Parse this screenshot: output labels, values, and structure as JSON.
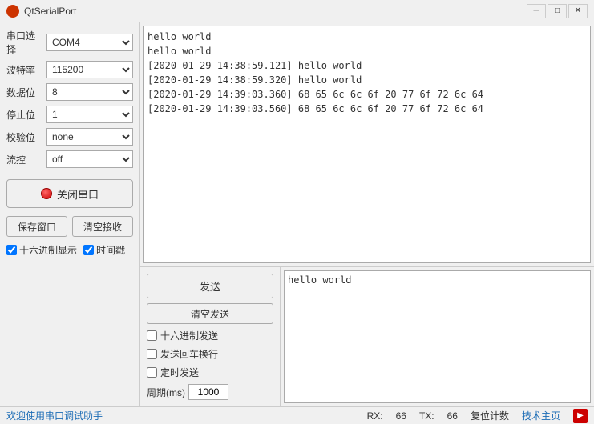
{
  "titleBar": {
    "title": "QtSerialPort",
    "minBtn": "─",
    "maxBtn": "□",
    "closeBtn": "✕"
  },
  "leftPanel": {
    "portLabel": "串口选择",
    "baudLabel": "波特率",
    "dataLabel": "数据位",
    "stopLabel": "停止位",
    "parityLabel": "校验位",
    "flowLabel": "流控",
    "portValue": "COM4",
    "baudValue": "115200",
    "dataValue": "8",
    "stopValue": "1",
    "parityValue": "none",
    "flowValue": "off",
    "openPortBtn": "关闭串口",
    "saveWindowBtn": "保存窗口",
    "clearDisplayBtn": "清空接收",
    "hexDisplay": "十六进制显示",
    "timeStamp": "时间戳"
  },
  "receiveArea": {
    "content": "hello world\nhello world\n[2020-01-29 14:38:59.121] hello world\n[2020-01-29 14:38:59.320] hello world\n[2020-01-29 14:39:03.360] 68 65 6c 6c 6f 20 77 6f 72 6c 64\n[2020-01-29 14:39:03.560] 68 65 6c 6c 6f 20 77 6f 72 6c 64"
  },
  "sendSection": {
    "sendBtn": "发送",
    "clearSendBtn": "清空发送",
    "hexSend": "十六进制发送",
    "crLf": "发送回车换行",
    "timedSend": "定时发送",
    "periodLabel": "周期(ms)",
    "periodValue": "1000",
    "sendContent": "hello world"
  },
  "statusBar": {
    "welcomeText": "欢迎使用串口调试助手",
    "rxLabel": "RX:",
    "rxValue": "66",
    "txLabel": "TX:",
    "txValue": "66",
    "resetLabel": "复位计数",
    "techLink": "技术主页"
  }
}
